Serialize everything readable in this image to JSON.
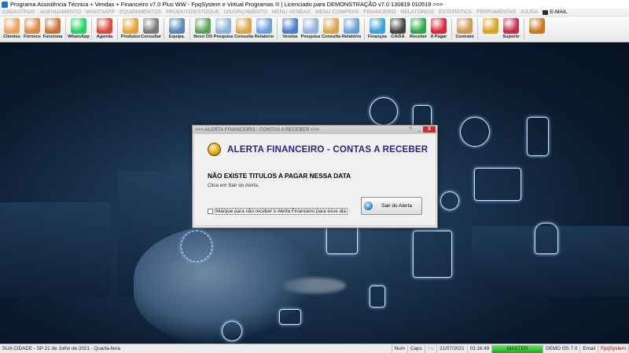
{
  "window": {
    "title": "Programa Assistência Técnica + Vendas + Financeiro v7.0 Plus WW - FpqSystem e Virtual Programas ® | Licenciado para  DEMONSTRAÇÃO v7.0 130819 010519 >>>"
  },
  "menu": {
    "items": [
      "CADASTROS",
      "AGENDAMENTO",
      "WHATSAPP",
      "EQUIPAMENTOS",
      "PRODUTO/ESTOQUE",
      "OS/ORÇAMENTO",
      "MENU VENDAS",
      "MENU COMPRAS",
      "FINANCEIRO",
      "RELATÓRIOS",
      "ESTATÍSTICA",
      "FERRAMENTAS",
      "AJUDA"
    ],
    "email": "E-MAIL"
  },
  "toolbar": {
    "buttons": [
      {
        "label": "Clientes",
        "icon": "clients-icon",
        "color": "#e8a25c"
      },
      {
        "label": "Fornece",
        "icon": "suppliers-icon",
        "color": "#d98b4a"
      },
      {
        "label": "Funciona",
        "icon": "employees-icon",
        "color": "#c7743b"
      },
      {
        "label": "WhatsApp",
        "icon": "whatsapp-icon",
        "color": "#25d366"
      },
      {
        "label": "Agenda",
        "icon": "calendar-icon",
        "color": "#d94b3c"
      },
      {
        "label": "Produtos",
        "icon": "products-icon",
        "color": "#e0a53a"
      },
      {
        "label": "Consultar",
        "icon": "search-products-icon",
        "color": "#7a7a7a"
      },
      {
        "label": "Equipa.",
        "icon": "equipment-icon",
        "color": "#5a86b5"
      },
      {
        "label": "Novo OS",
        "icon": "new-os-icon",
        "color": "#5fa05f"
      },
      {
        "label": "Pesquisa",
        "icon": "search-os-icon",
        "color": "#8fb3d9"
      },
      {
        "label": "Consulta",
        "icon": "query-os-icon",
        "color": "#d9a64a"
      },
      {
        "label": "Relatório",
        "icon": "report-os-icon",
        "color": "#6aa0d8"
      },
      {
        "label": "Vendas",
        "icon": "sales-icon",
        "color": "#4a7fc0"
      },
      {
        "label": "Pesquisa",
        "icon": "search-sales-icon",
        "color": "#8fb3d9"
      },
      {
        "label": "Consulta",
        "icon": "query-sales-icon",
        "color": "#d9a64a"
      },
      {
        "label": "Relatório",
        "icon": "report-sales-icon",
        "color": "#6aa0d8"
      },
      {
        "label": "Finanças",
        "icon": "finance-icon",
        "color": "#3f9fd8"
      },
      {
        "label": "CAIXA",
        "icon": "cashier-icon",
        "color": "#444444"
      },
      {
        "label": "Receber",
        "icon": "receive-icon",
        "color": "#2fa84f"
      },
      {
        "label": "A Pagar",
        "icon": "pay-icon",
        "color": "#d8283a"
      },
      {
        "label": "Contrato",
        "icon": "contract-icon",
        "color": "#c99a52"
      },
      {
        "label": "",
        "icon": "coins-icon",
        "color": "#d9a520"
      },
      {
        "label": "Suporte",
        "icon": "support-icon",
        "color": "#c0304a"
      },
      {
        "label": "",
        "icon": "exit-door-icon",
        "color": "#c8781f"
      }
    ]
  },
  "dialog": {
    "title": ">>> ALERTA FINANCEIRO - CONTAS A RECEBER <<<",
    "help_glyph": "?",
    "min_glyph": "_",
    "close_glyph": "X",
    "heading": "ALERTA FINANCEIRO - CONTAS A RECEBER",
    "message": "NÃO EXISTE TITULOS A PAGAR NESSA DATA",
    "hint": "Clica em Sair do Alerta.",
    "checkbox_label": "Marque para não receber o Alerta Financeiro para esse dia",
    "checkbox_checked": false,
    "exit_button": "Sair do Alerta"
  },
  "statusbar": {
    "city": "SUA CIDADE - SP 21 de Julho de 2021 - Quarta-feira",
    "num": "Num",
    "caps": "Caps",
    "ins": "Ins",
    "date": "21/07/2021",
    "time": "03:16:49",
    "master": "MASTER",
    "version": "DEMO OS 7.0",
    "email": "Email",
    "brand": "FpqSystem"
  }
}
